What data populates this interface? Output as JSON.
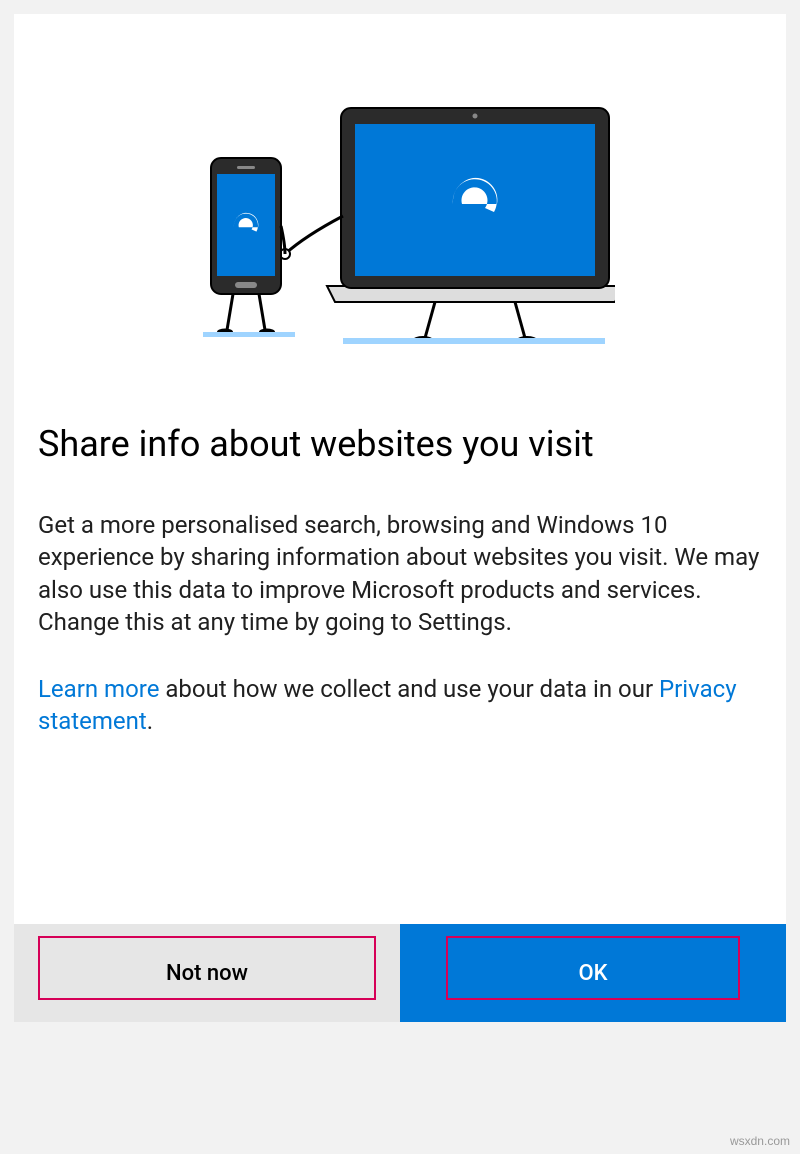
{
  "heading": "Share info about websites you visit",
  "paragraph1": "Get a more personalised search, browsing and Windows 10 experience by sharing information about websites you visit. We may also use this data to improve Microsoft products and services. Change this at any time by going to Settings.",
  "link_learn_more": "Learn more",
  "paragraph2_mid": " about how we collect and use your data in our ",
  "link_privacy": "Privacy statement",
  "paragraph2_end": ".",
  "button_not_now": "Not now",
  "button_ok": "OK",
  "watermark": "wsxdn.com"
}
